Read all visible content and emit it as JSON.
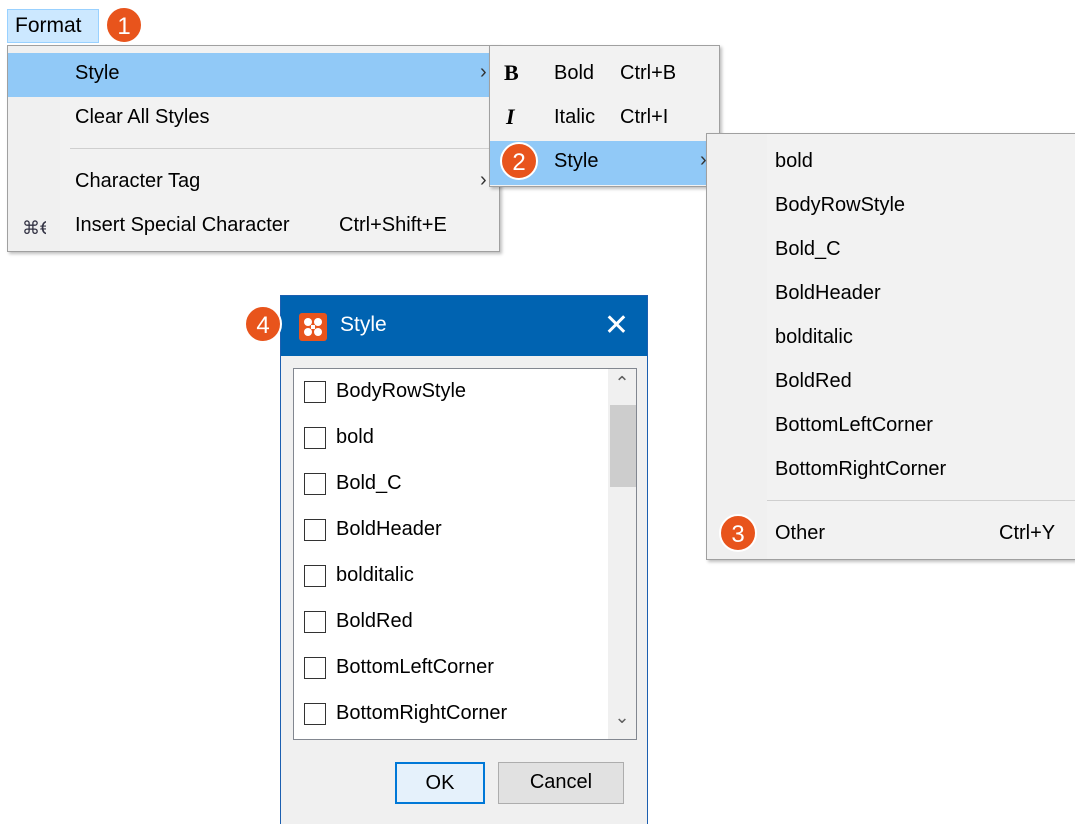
{
  "menubar": {
    "format_label": "Format"
  },
  "badges": [
    "1",
    "2",
    "3",
    "4"
  ],
  "format_menu": {
    "style_label": "Style",
    "clear_label": "Clear All Styles",
    "char_tag_label": "Character Tag",
    "insert_label": "Insert Special Character",
    "insert_shortcut": "Ctrl+Shift+E",
    "submenu_arrow": "›"
  },
  "style_menu": {
    "bold_label": "Bold",
    "bold_shortcut": "Ctrl+B",
    "bold_glyph": "B",
    "italic_label": "Italic",
    "italic_shortcut": "Ctrl+I",
    "italic_glyph": "I",
    "style_label": "Style"
  },
  "styles_menu": {
    "items": [
      "bold",
      "BodyRowStyle",
      "Bold_C",
      "BoldHeader",
      "bolditalic",
      "BoldRed",
      "BottomLeftCorner",
      "BottomRightCorner"
    ],
    "other_label": "Other",
    "other_shortcut": "Ctrl+Y"
  },
  "dialog": {
    "title": "Style",
    "close_glyph": "✕",
    "items": [
      "BodyRowStyle",
      "bold",
      "Bold_C",
      "BoldHeader",
      "bolditalic",
      "BoldRed",
      "BottomLeftCorner",
      "BottomRightCorner"
    ],
    "ok_label": "OK",
    "cancel_label": "Cancel",
    "scroll_up": "⌃",
    "scroll_down": "⌄"
  },
  "colors": {
    "highlight": "#91c9f7",
    "badge": "#e8541c",
    "titlebar": "#0063b1"
  }
}
